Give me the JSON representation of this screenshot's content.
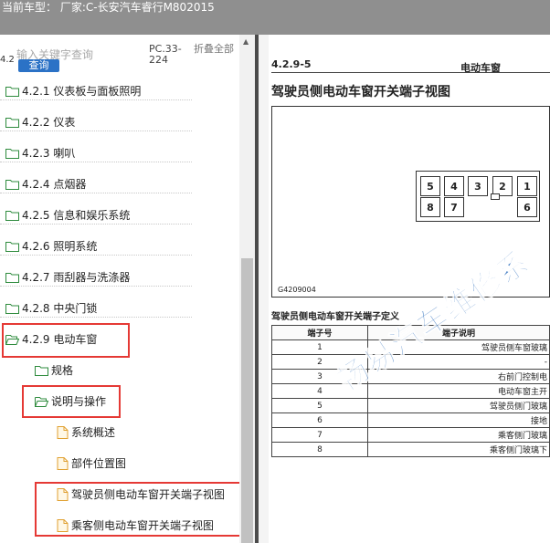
{
  "header": {
    "title": "当前车型： 厂家:C-长安汽车睿行M802015"
  },
  "toolbar": {
    "cutoff_text": "4.2",
    "search_placeholder": "输入关键字查询",
    "search_button": "查询",
    "col_pc": "PC.33-224",
    "col_fold": "折叠全部"
  },
  "tree": {
    "items": [
      {
        "label": "4.2.1 仪表板与面板照明",
        "icon": "folder-closed-icon"
      },
      {
        "label": "4.2.2 仪表",
        "icon": "folder-closed-icon"
      },
      {
        "label": "4.2.3 喇叭",
        "icon": "folder-closed-icon"
      },
      {
        "label": "4.2.4 点烟器",
        "icon": "folder-closed-icon"
      },
      {
        "label": "4.2.5 信息和娱乐系统",
        "icon": "folder-closed-icon"
      },
      {
        "label": "4.2.6 照明系统",
        "icon": "folder-closed-icon"
      },
      {
        "label": "4.2.7 雨刮器与洗涤器",
        "icon": "folder-closed-icon"
      },
      {
        "label": "4.2.8 中央门锁",
        "icon": "folder-closed-icon"
      },
      {
        "label": "4.2.9 电动车窗",
        "icon": "folder-open-icon"
      },
      {
        "label": "规格",
        "icon": "folder-closed-icon"
      },
      {
        "label": "说明与操作",
        "icon": "folder-open-icon"
      },
      {
        "label": "系统概述",
        "icon": "document-icon"
      },
      {
        "label": "部件位置图",
        "icon": "document-icon"
      },
      {
        "label": "驾驶员侧电动车窗开关端子视图",
        "icon": "document-icon"
      },
      {
        "label": "乘客侧电动车窗开关端子视图",
        "icon": "document-icon"
      }
    ]
  },
  "doc": {
    "section_number": "4.2.9-5",
    "section_name": "电动车窗",
    "heading": "驾驶员侧电动车窗开关端子视图",
    "pins_top": [
      "5",
      "4",
      "3",
      "2",
      "1"
    ],
    "pins_bottom": [
      "8",
      "7",
      "6"
    ],
    "figure_id": "G4209004",
    "table_title": "驾驶员侧电动车窗开关端子定义",
    "table_header": [
      "端子号",
      "端子说明"
    ],
    "rows": [
      {
        "pin": "1",
        "desc": "驾驶员侧车窗玻璃"
      },
      {
        "pin": "2",
        "desc": "-"
      },
      {
        "pin": "3",
        "desc": "右前门控制电"
      },
      {
        "pin": "4",
        "desc": "电动车窗主开"
      },
      {
        "pin": "5",
        "desc": "驾驶员侧门玻璃"
      },
      {
        "pin": "6",
        "desc": "接地"
      },
      {
        "pin": "7",
        "desc": "乘客侧门玻璃"
      },
      {
        "pin": "8",
        "desc": "乘客侧门玻璃下"
      }
    ],
    "watermark": "畅易汽车维修系"
  },
  "colors": {
    "highlight": "#e53935",
    "accent": "#2b72c6",
    "header_bg": "#8f8f8f"
  }
}
